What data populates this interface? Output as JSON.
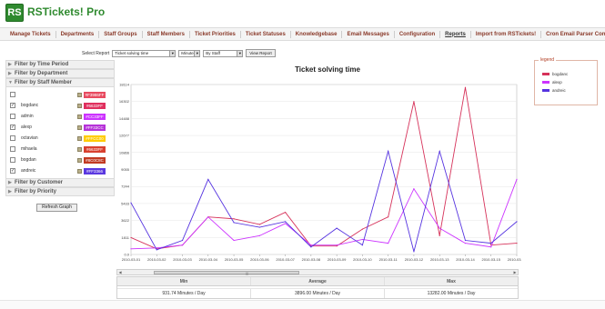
{
  "app": {
    "logo_text": "RS",
    "title": "RSTickets! Pro"
  },
  "nav": [
    {
      "label": "Manage Tickets"
    },
    {
      "label": "Departments"
    },
    {
      "label": "Staff Groups"
    },
    {
      "label": "Staff Members"
    },
    {
      "label": "Ticket Priorities"
    },
    {
      "label": "Ticket Statuses"
    },
    {
      "label": "Knowledgebase"
    },
    {
      "label": "Email Messages"
    },
    {
      "label": "Configuration"
    },
    {
      "label": "Reports",
      "active": true
    },
    {
      "label": "Import from RSTickets!"
    },
    {
      "label": "Cron Email Parser Configuration"
    }
  ],
  "controls": {
    "select_report_label": "Select Report",
    "report_value": "Ticket solving time",
    "unit_value": "Minutes",
    "group_value": "By Staff",
    "view_button": "View Report"
  },
  "filters": {
    "time_period": "Filter by Time Period",
    "department": "Filter by Department",
    "staff_member": "Filter by Staff Member",
    "customer": "Filter by Customer",
    "priority": "Filter by Priority",
    "refresh_button": "Refresh Graph"
  },
  "staff": [
    {
      "name": "",
      "checked": false,
      "color": "#F3986FF",
      "bg": "#e84a5f"
    },
    {
      "name": "bogdanc",
      "checked": true,
      "color": "#6633FF",
      "bg": "#e0305e"
    },
    {
      "name": "admin",
      "checked": false,
      "color": "#CC33FF",
      "bg": "#cc33ff"
    },
    {
      "name": "alexp",
      "checked": true,
      "color": "#FF33CC",
      "bg": "#b633d8"
    },
    {
      "name": "octavian",
      "checked": false,
      "color": "#FFCC00",
      "bg": "#ffcc00"
    },
    {
      "name": "mihaela",
      "checked": false,
      "color": "#6633FF",
      "bg": "#d8402f"
    },
    {
      "name": "bogdan",
      "checked": false,
      "color": "#8C0C8C",
      "bg": "#c23a22"
    },
    {
      "name": "andreic",
      "checked": true,
      "color": "#FF3366",
      "bg": "#5a38e0"
    }
  ],
  "chart_data": {
    "type": "line",
    "title": "Ticket solving time",
    "legend_title": "legend",
    "legend_position": "top-right",
    "x": [
      "2010-03-01",
      "2010-03-02",
      "2010-03-03",
      "2010-03-04",
      "2010-03-05",
      "2010-03-06",
      "2010-03-07",
      "2010-03-08",
      "2010-03-09",
      "2010-03-10",
      "2010-03-11",
      "2010-03-12",
      "2010-03-13",
      "2010-03-14",
      "2010-03-15",
      "2010-03-16"
    ],
    "y_ticks": [
      "0.0",
      "1811",
      "3622",
      "5433",
      "7244",
      "9055",
      "10866",
      "12677",
      "14488",
      "16302",
      "18114"
    ],
    "ylim": [
      0,
      18114
    ],
    "series": [
      {
        "name": "bogdanc",
        "color": "#d6325a",
        "values": [
          1800,
          600,
          1000,
          4000,
          3800,
          3200,
          4500,
          900,
          900,
          2700,
          4000,
          16300,
          2000,
          17800,
          1000,
          1200
        ]
      },
      {
        "name": "alexp",
        "color": "#cc33ff",
        "values": [
          600,
          700,
          1000,
          4000,
          1500,
          2000,
          3300,
          1000,
          1000,
          1600,
          1200,
          7000,
          2800,
          1200,
          800,
          8000
        ]
      },
      {
        "name": "andreic",
        "color": "#5533e0",
        "values": [
          5500,
          500,
          1500,
          8000,
          3400,
          2900,
          3500,
          800,
          2800,
          1000,
          11000,
          300,
          11000,
          1500,
          1200,
          3500
        ]
      }
    ]
  },
  "stats": {
    "headers": [
      "Min",
      "Average",
      "Max"
    ],
    "values": [
      "931.74 Minutes / Day",
      "3896.00 Minutes / Day",
      "13282.00 Minutes / Day"
    ]
  }
}
